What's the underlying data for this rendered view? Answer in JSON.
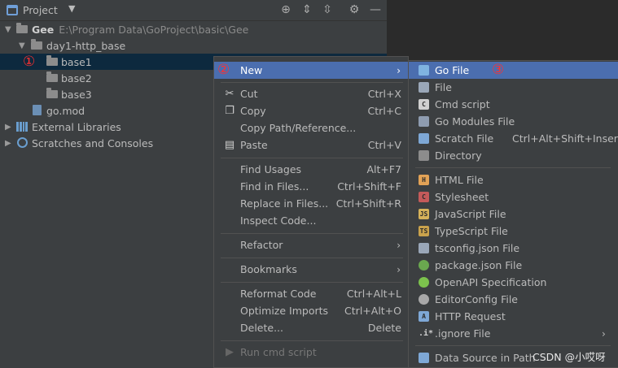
{
  "toolbar": {
    "title": "Project"
  },
  "tree": {
    "root_label": "Gee",
    "root_path": "E:\\Program Data\\GoProject\\basic\\Gee",
    "folder_day1": "day1-http_base",
    "base1": "base1",
    "base2": "base2",
    "base3": "base3",
    "gomod": "go.mod",
    "external_libraries": "External Libraries",
    "scratches": "Scratches and Consoles"
  },
  "markers": {
    "m1": "①",
    "m2": "②",
    "m3": "③"
  },
  "context_menu": {
    "new": "New",
    "cut": "Cut",
    "cut_sc": "Ctrl+X",
    "copy": "Copy",
    "copy_sc": "Ctrl+C",
    "copy_path": "Copy Path/Reference...",
    "paste": "Paste",
    "paste_sc": "Ctrl+V",
    "find_usages": "Find Usages",
    "find_usages_sc": "Alt+F7",
    "find_in_files": "Find in Files...",
    "find_in_files_sc": "Ctrl+Shift+F",
    "replace_in_files": "Replace in Files...",
    "replace_in_files_sc": "Ctrl+Shift+R",
    "inspect_code": "Inspect Code...",
    "refactor": "Refactor",
    "bookmarks": "Bookmarks",
    "reformat_code": "Reformat Code",
    "reformat_code_sc": "Ctrl+Alt+L",
    "optimize_imports": "Optimize Imports",
    "optimize_imports_sc": "Ctrl+Alt+O",
    "delete": "Delete...",
    "delete_sc": "Delete",
    "run_cmd_script": "Run cmd script"
  },
  "submenu": {
    "go_file": "Go File",
    "file": "File",
    "cmd_script": "Cmd script",
    "go_modules_file": "Go Modules File",
    "scratch_file": "Scratch File",
    "scratch_file_sc": "Ctrl+Alt+Shift+Insert",
    "directory": "Directory",
    "html_file": "HTML File",
    "stylesheet": "Stylesheet",
    "javascript_file": "JavaScript File",
    "typescript_file": "TypeScript File",
    "tsconfig_file": "tsconfig.json File",
    "package_json_file": "package.json File",
    "openapi_spec": "OpenAPI Specification",
    "editorconfig_file": "EditorConfig File",
    "http_request": "HTTP Request",
    "ignore_file": ".ignore File",
    "data_source_in_path": "Data Source in Path"
  },
  "watermark": "CSDN @小哎呀",
  "colors": {
    "highlight": "#4b6eaf",
    "selected_row": "#0d293e",
    "marker": "#ff3030"
  }
}
